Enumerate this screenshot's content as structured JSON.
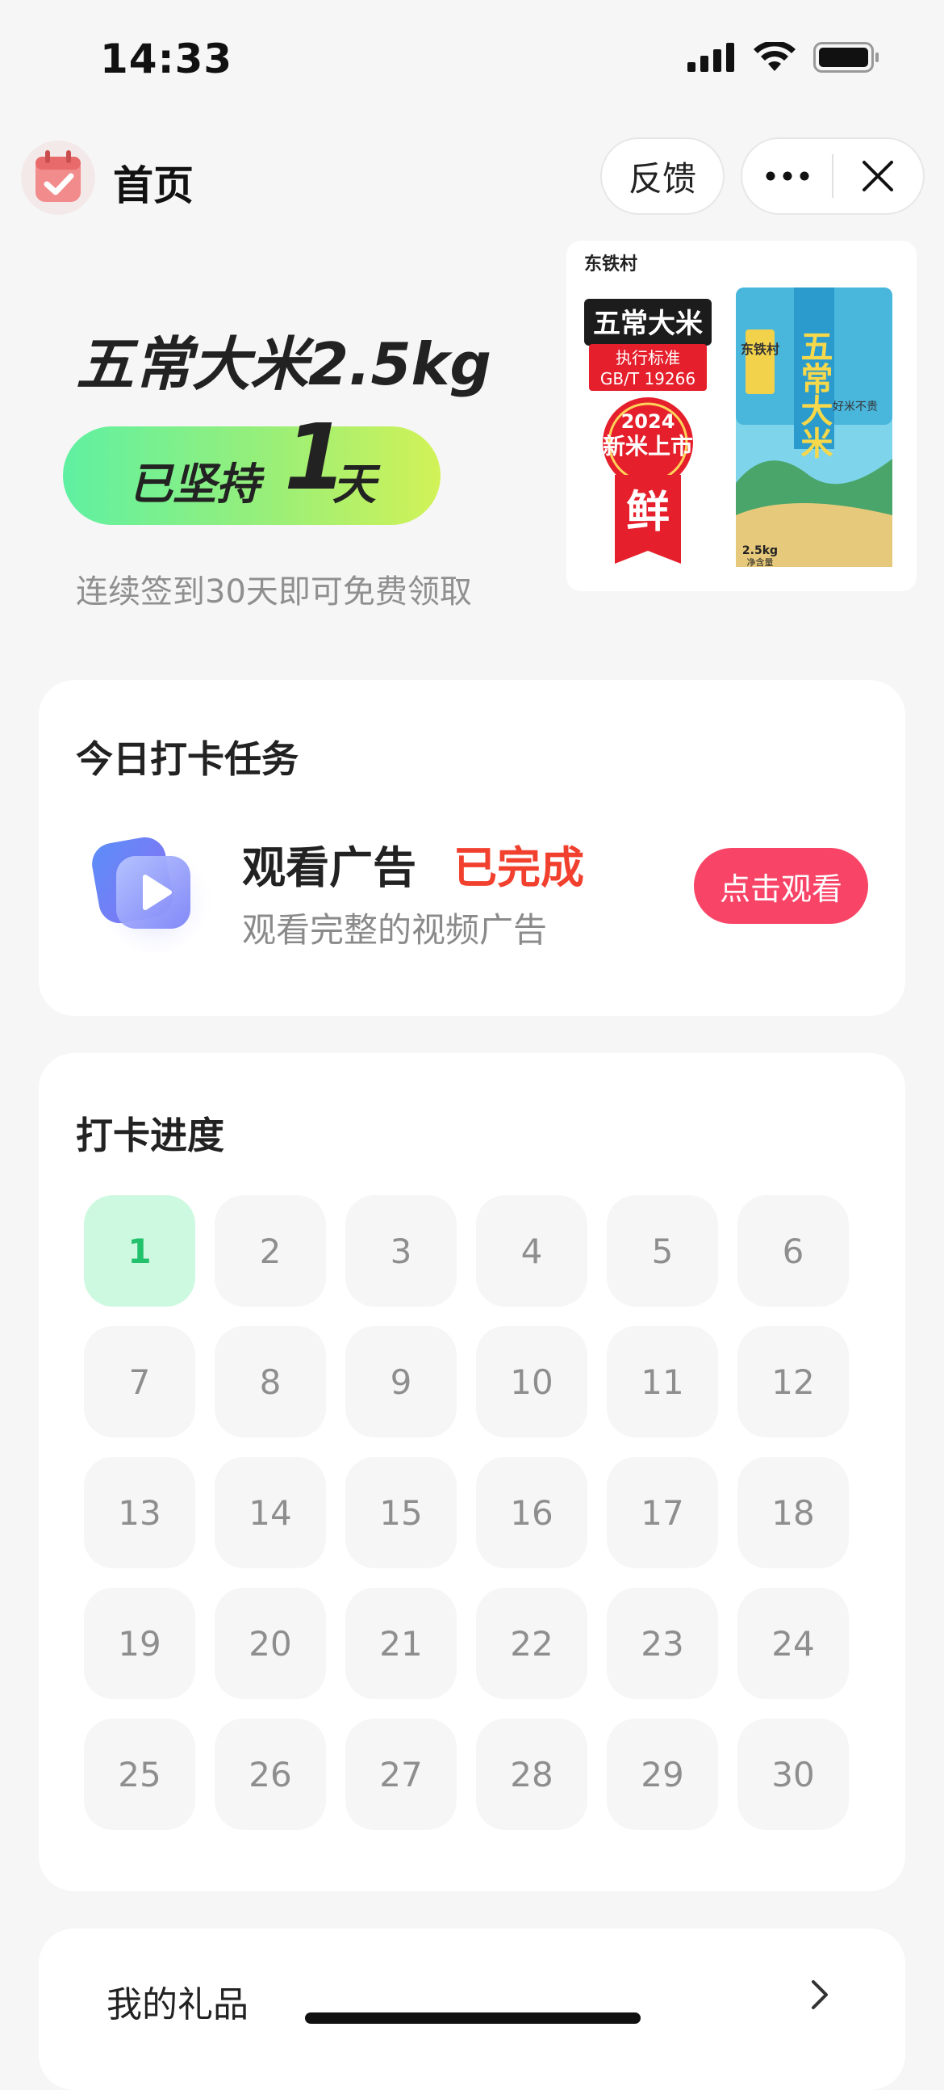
{
  "status_bar": {
    "time": "14:33"
  },
  "header": {
    "title": "首页",
    "feedback_label": "反馈"
  },
  "hero": {
    "prize_name": "五常大米2.5kg",
    "streak_prefix": "已坚持",
    "streak_days": "1",
    "streak_suffix": "天",
    "description": "连续签到30天即可免费领取",
    "product": {
      "brand": "东铁村",
      "line1": "五常大米",
      "standard_label": "执行标准",
      "standard_code": "GB/T 19266",
      "year": "2024",
      "badge": "新米上市",
      "fresh": "鲜",
      "bag_brand": "东铁村",
      "bag_title": "五常大米",
      "bag_slogan": "好米不贵",
      "bag_weight": "2.5kg",
      "bag_net": "净含量"
    }
  },
  "task_section": {
    "title": "今日打卡任务",
    "task_name": "观看广告",
    "task_status": "已完成",
    "task_desc": "观看完整的视频广告",
    "button_label": "点击观看"
  },
  "progress_section": {
    "title": "打卡进度",
    "days": [
      "1",
      "2",
      "3",
      "4",
      "5",
      "6",
      "7",
      "8",
      "9",
      "10",
      "11",
      "12",
      "13",
      "14",
      "15",
      "16",
      "17",
      "18",
      "19",
      "20",
      "21",
      "22",
      "23",
      "24",
      "25",
      "26",
      "27",
      "28",
      "29",
      "30"
    ],
    "completed_days": 1
  },
  "gift_section": {
    "label": "我的礼品"
  },
  "colors": {
    "accent_red": "#f2402f",
    "button_pink": "#f84467",
    "done_green": "#22c16b",
    "done_bg": "#cdf9e0"
  },
  "icons": [
    "signal-icon",
    "wifi-icon",
    "battery-icon",
    "calendar-app-icon",
    "more-icon",
    "close-icon",
    "play-icon",
    "chevron-right-icon"
  ]
}
